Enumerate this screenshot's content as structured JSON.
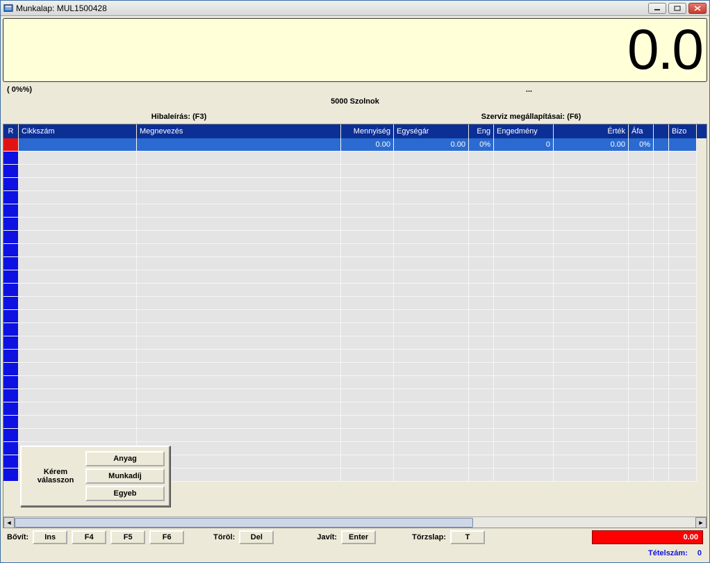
{
  "window": {
    "title": "Munkalap:  MUL1500428"
  },
  "display": {
    "value": "0.0"
  },
  "info": {
    "left": "( 0%%)",
    "right": "...",
    "city": "5000 Szolnok"
  },
  "sections": {
    "left": "Hibaleírás:  (F3)",
    "right": "Szerviz megállapításai:  (F6)"
  },
  "grid": {
    "columns": {
      "r": "R",
      "cikkszam": "Cikkszám",
      "megnevezes": "Megnevezés",
      "mennyiseg": "Mennyiség",
      "egysegar": "Egységár",
      "eng": "Eng",
      "engedmeny": "Engedmény",
      "ertek": "Érték",
      "afa": "Áfa",
      "biz": "Bizo"
    },
    "selected_row": {
      "cikkszam": "",
      "megnevezes": "",
      "mennyiseg": "0.00",
      "egysegar": "0.00",
      "eng": "0%",
      "engedmeny": "0",
      "ertek": "0.00",
      "afa": "0%",
      "biz": ""
    },
    "empty_row_count": 25
  },
  "popup": {
    "label": "Kérem válasszon",
    "buttons": {
      "anyag": "Anyag",
      "munkadij": "Munkadíj",
      "egyeb": "Egyeb"
    }
  },
  "footer": {
    "bovit_label": "Bővít:",
    "ins": "Ins",
    "f4": "F4",
    "f5": "F5",
    "f6": "F6",
    "torol_label": "Töröl:",
    "del": "Del",
    "javit_label": "Javít:",
    "enter": "Enter",
    "torzslap_label": "Törzslap:",
    "t": "T",
    "total": "0.00"
  },
  "status": {
    "tetelszam_label": "Tételszám:",
    "tetelszam_value": "0"
  }
}
